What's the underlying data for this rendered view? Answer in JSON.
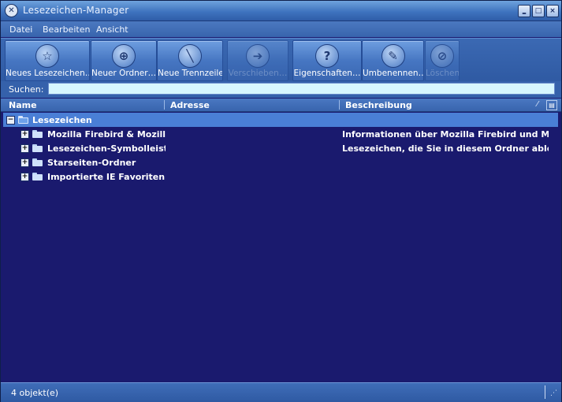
{
  "window": {
    "title": "Lesezeichen-Manager",
    "icon": "firebird-icon",
    "controls": {
      "minimize": "‗",
      "maximize": "□",
      "close": "×"
    }
  },
  "menu": {
    "items": [
      {
        "label": "Datei"
      },
      {
        "label": "Bearbeiten"
      },
      {
        "label": "Ansicht"
      }
    ]
  },
  "toolbar": {
    "buttons": [
      {
        "label": "Neues Lesezeichen…",
        "icon": "star-icon",
        "glyph": "☆",
        "enabled": true
      },
      {
        "label": "Neuer Ordner…",
        "icon": "new-folder-icon",
        "glyph": "⊕",
        "enabled": true
      },
      {
        "label": "Neue Trennzeile",
        "icon": "separator-icon",
        "glyph": "╲",
        "enabled": true
      },
      {
        "label": "Verschieben…",
        "icon": "move-icon",
        "glyph": "➔",
        "enabled": false
      },
      {
        "label": "Eigenschaften…",
        "icon": "help-icon",
        "glyph": "?",
        "enabled": true
      },
      {
        "label": "Umbenennen…",
        "icon": "pencil-icon",
        "glyph": "✎",
        "enabled": true
      },
      {
        "label": "Löschen",
        "icon": "delete-icon",
        "glyph": "⊘",
        "enabled": false
      }
    ]
  },
  "search": {
    "label": "Suchen:",
    "value": "",
    "placeholder": ""
  },
  "columns": {
    "name": "Name",
    "address": "Adresse",
    "description": "Beschreibung",
    "sort_mark": "⁄",
    "picker_glyph": "▤"
  },
  "tree": {
    "root": {
      "label": "Lesezeichen",
      "expanded": true,
      "twisty": "−"
    },
    "rows": [
      {
        "name": "Mozilla Firebird & Mozilla ...",
        "address": "",
        "description": "Informationen über Mozilla Firebird und Moz...",
        "twisty": "+"
      },
      {
        "name": "Lesezeichen-Symbolleiste",
        "address": "",
        "description": "Lesezeichen, die Sie in diesem Ordner able...",
        "twisty": "+"
      },
      {
        "name": "Starseiten-Ordner",
        "address": "",
        "description": "",
        "twisty": "+"
      },
      {
        "name": "Importierte IE Favoriten",
        "address": "",
        "description": "",
        "twisty": "+"
      }
    ]
  },
  "status": {
    "text": "4 objekt(e)",
    "grip": "⋰"
  },
  "colors": {
    "tree_background": "#1a1a6e",
    "selection": "#4a7fd6",
    "chrome": "#3864ad",
    "search_field": "#d7f6ff"
  }
}
